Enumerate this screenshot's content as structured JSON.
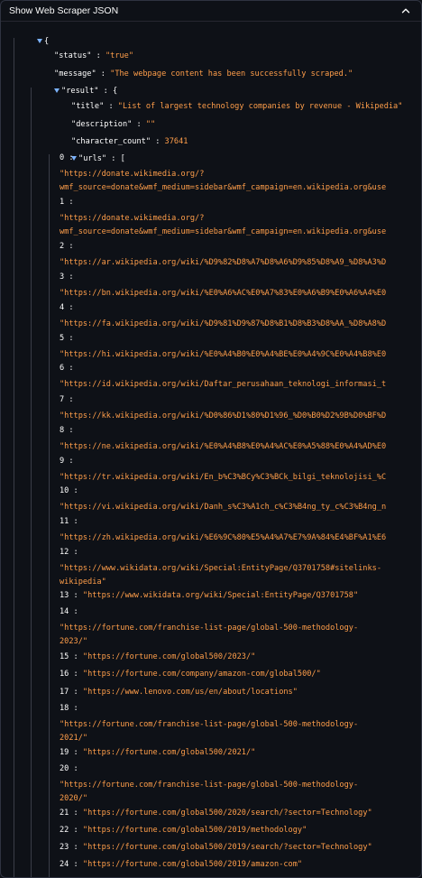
{
  "panel": {
    "title": "Show Web Scraper JSON"
  },
  "json": {
    "status_key": "\"status\"",
    "status_val": "\"true\"",
    "message_key": "\"message\"",
    "message_val": "\"The webpage content has been successfully scraped.\"",
    "result_key": "\"result\"",
    "title_key": "\"title\"",
    "title_val": "\"List of largest technology companies by revenue - Wikipedia\"",
    "description_key": "\"description\"",
    "description_val": "\"\"",
    "character_count_key": "\"character_count\"",
    "character_count_val": "37641",
    "urls_key": "\"urls\"",
    "urls": [
      {
        "idx": "0",
        "line1": "\"https://donate.wikimedia.org/?",
        "line2": "wmf_source=donate&wmf_medium=sidebar&wmf_campaign=en.wikipedia.org&use"
      },
      {
        "idx": "1",
        "line1": "\"https://donate.wikimedia.org/?",
        "line2": "wmf_source=donate&wmf_medium=sidebar&wmf_campaign=en.wikipedia.org&use"
      },
      {
        "idx": "2",
        "line1": "\"https://ar.wikipedia.org/wiki/%D9%82%D8%A7%D8%A6%D9%85%D8%A9_%D8%A3%D"
      },
      {
        "idx": "3",
        "line1": "\"https://bn.wikipedia.org/wiki/%E0%A6%AC%E0%A7%83%E0%A6%B9%E0%A6%A4%E0"
      },
      {
        "idx": "4",
        "line1": "\"https://fa.wikipedia.org/wiki/%D9%81%D9%87%D8%B1%D8%B3%D8%AA_%D8%A8%D"
      },
      {
        "idx": "5",
        "line1": "\"https://hi.wikipedia.org/wiki/%E0%A4%B0%E0%A4%BE%E0%A4%9C%E0%A4%B8%E0"
      },
      {
        "idx": "6",
        "line1": "\"https://id.wikipedia.org/wiki/Daftar_perusahaan_teknologi_informasi_t"
      },
      {
        "idx": "7",
        "line1": "\"https://kk.wikipedia.org/wiki/%D0%86%D1%80%D1%96_%D0%B0%D2%9B%D0%BF%D"
      },
      {
        "idx": "8",
        "line1": "\"https://ne.wikipedia.org/wiki/%E0%A4%B8%E0%A4%AC%E0%A5%88%E0%A4%AD%E0"
      },
      {
        "idx": "9",
        "line1": "\"https://tr.wikipedia.org/wiki/En_b%C3%BCy%C3%BCk_bilgi_teknolojisi_%C"
      },
      {
        "idx": "10",
        "line1": "\"https://vi.wikipedia.org/wiki/Danh_s%C3%A1ch_c%C3%B4ng_ty_c%C3%B4ng_n"
      },
      {
        "idx": "11",
        "line1": "\"https://zh.wikipedia.org/wiki/%E6%9C%80%E5%A4%A7%E7%9A%84%E4%BF%A1%E6"
      },
      {
        "idx": "12",
        "line1": "\"https://www.wikidata.org/wiki/Special:EntityPage/Q3701758#sitelinks-",
        "line2": "wikipedia\""
      },
      {
        "idx": "13",
        "inline": "\"https://www.wikidata.org/wiki/Special:EntityPage/Q3701758\""
      },
      {
        "idx": "14",
        "line1": "\"https://fortune.com/franchise-list-page/global-500-methodology-",
        "line2": "2023/\""
      },
      {
        "idx": "15",
        "inline": "\"https://fortune.com/global500/2023/\""
      },
      {
        "idx": "16",
        "inline": "\"https://fortune.com/company/amazon-com/global500/\""
      },
      {
        "idx": "17",
        "inline": "\"https://www.lenovo.com/us/en/about/locations\""
      },
      {
        "idx": "18",
        "line1": "\"https://fortune.com/franchise-list-page/global-500-methodology-",
        "line2": "2021/\""
      },
      {
        "idx": "19",
        "inline": "\"https://fortune.com/global500/2021/\""
      },
      {
        "idx": "20",
        "line1": "\"https://fortune.com/franchise-list-page/global-500-methodology-",
        "line2": "2020/\""
      },
      {
        "idx": "21",
        "inline": "\"https://fortune.com/global500/2020/search/?sector=Technology\""
      },
      {
        "idx": "22",
        "inline": "\"https://fortune.com/global500/2019/methodology\""
      },
      {
        "idx": "23",
        "inline": "\"https://fortune.com/global500/2019/search/?sector=Technology\""
      },
      {
        "idx": "24",
        "inline": "\"https://fortune.com/global500/2019/amazon-com\""
      }
    ]
  },
  "colors": {
    "string": "#ff9e4a",
    "background": "#0e1117",
    "toggle": "#7cb3ff"
  },
  "icons": {
    "collapse": "chevron-up-icon",
    "toggle": "triangle-down-icon"
  }
}
